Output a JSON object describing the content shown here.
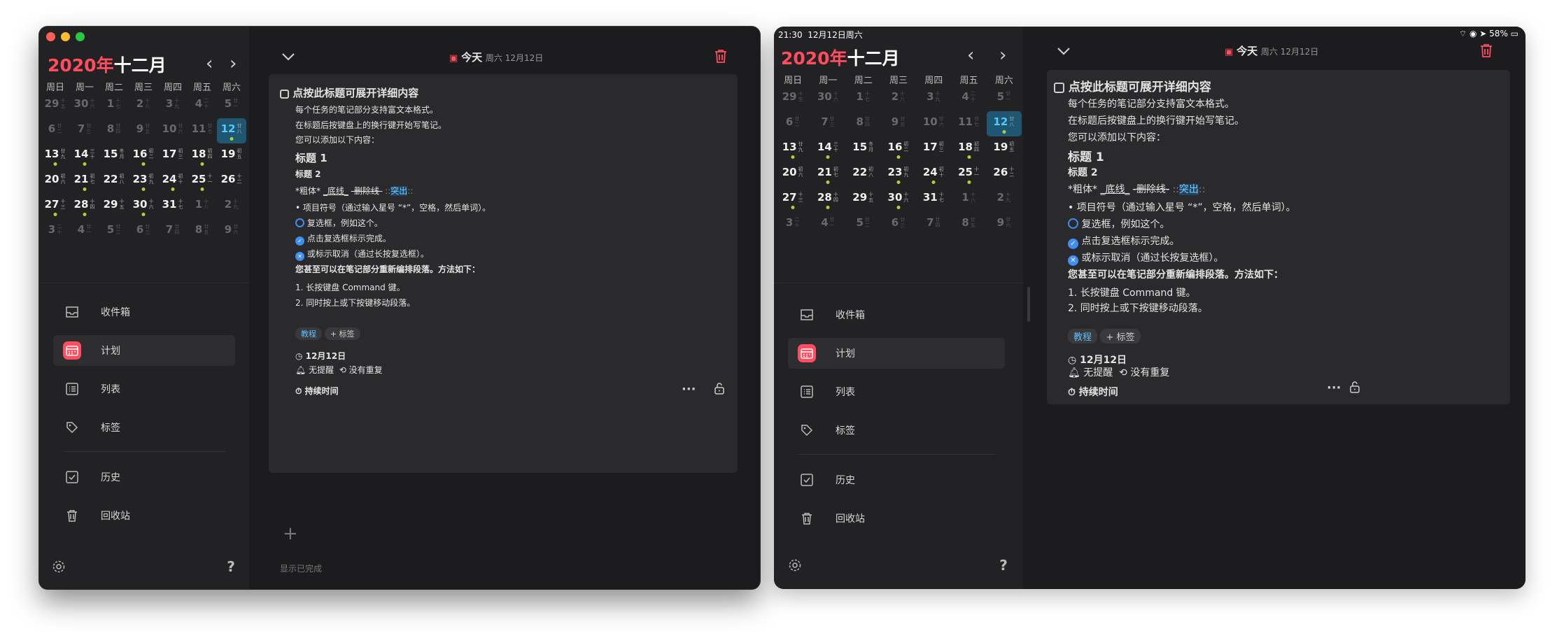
{
  "calendar": {
    "year": "2020年",
    "month": "十二月",
    "weekdays": [
      "周日",
      "周一",
      "周二",
      "周三",
      "周四",
      "周五",
      "周六"
    ],
    "weeks": [
      [
        {
          "d": "29",
          "l": "十五",
          "m": 1
        },
        {
          "d": "30",
          "l": "十六",
          "m": 1
        },
        {
          "d": "1",
          "l": "十七",
          "m": 1
        },
        {
          "d": "2",
          "l": "十八",
          "m": 1
        },
        {
          "d": "3",
          "l": "十九",
          "m": 1
        },
        {
          "d": "4",
          "l": "二十",
          "m": 1
        },
        {
          "d": "5",
          "l": "廿一",
          "m": 1
        }
      ],
      [
        {
          "d": "6",
          "l": "廿二",
          "m": 1
        },
        {
          "d": "7",
          "l": "廿三",
          "m": 1
        },
        {
          "d": "8",
          "l": "廿四",
          "m": 1
        },
        {
          "d": "9",
          "l": "廿五",
          "m": 1
        },
        {
          "d": "10",
          "l": "廿六",
          "m": 1
        },
        {
          "d": "11",
          "l": "廿七",
          "m": 1
        },
        {
          "d": "12",
          "l": "廿八",
          "t": 1,
          "dot": 1
        }
      ],
      [
        {
          "d": "13",
          "l": "廿九",
          "dot": 1
        },
        {
          "d": "14",
          "l": "三十",
          "dot": 1
        },
        {
          "d": "15",
          "l": "冬月"
        },
        {
          "d": "16",
          "l": "初二",
          "dot": 1
        },
        {
          "d": "17",
          "l": "初三"
        },
        {
          "d": "18",
          "l": "初四",
          "dot": 1
        },
        {
          "d": "19",
          "l": "初五"
        }
      ],
      [
        {
          "d": "20",
          "l": "初六"
        },
        {
          "d": "21",
          "l": "初七",
          "dot": 1
        },
        {
          "d": "22",
          "l": "初八"
        },
        {
          "d": "23",
          "l": "初九",
          "dot": 1
        },
        {
          "d": "24",
          "l": "初十",
          "dot": 1
        },
        {
          "d": "25",
          "l": "十一",
          "dot": 1
        },
        {
          "d": "26",
          "l": "十二"
        }
      ],
      [
        {
          "d": "27",
          "l": "十三",
          "dot": 1
        },
        {
          "d": "28",
          "l": "十四",
          "dot": 1
        },
        {
          "d": "29",
          "l": "十五"
        },
        {
          "d": "30",
          "l": "十六",
          "dot": 1
        },
        {
          "d": "31",
          "l": "十七"
        },
        {
          "d": "1",
          "l": "十八",
          "m": 1
        },
        {
          "d": "2",
          "l": "十九",
          "m": 1
        }
      ],
      [
        {
          "d": "3",
          "l": "二十",
          "m": 1
        },
        {
          "d": "4",
          "l": "廿一",
          "m": 1
        },
        {
          "d": "5",
          "l": "廿二",
          "m": 1
        },
        {
          "d": "6",
          "l": "廿三",
          "m": 1
        },
        {
          "d": "7",
          "l": "廿四",
          "m": 1
        },
        {
          "d": "8",
          "l": "廿五",
          "m": 1
        },
        {
          "d": "9",
          "l": "廿六",
          "m": 1
        }
      ]
    ]
  },
  "menu": {
    "inbox": "收件箱",
    "plan": "计划",
    "list": "列表",
    "tags": "标签",
    "history": "历史",
    "trash": "回收站"
  },
  "header": {
    "today": "今天",
    "date": "周六 12月12日"
  },
  "task": {
    "title": "点按此标题可展开详细内容",
    "line1": "每个任务的笔记部分支持富文本格式。",
    "line2": "在标题后按键盘上的换行键开始写笔记。",
    "line3": "您可以添加以下内容：",
    "h1": "标题 1",
    "h2": "标题 2",
    "fmt_bold": "*粗体*",
    "fmt_ul": "_底线_",
    "fmt_st": "-删除线-",
    "fmt_hl_pre": "::",
    "fmt_hl": "突出",
    "fmt_hl_post": "::",
    "bullet": "项目符号（通过输入星号 “*”，空格，然后单词）。",
    "check_open": "复选框，例如这个。",
    "check_done": "点击复选框标示完成。",
    "check_cancel": "或标示取消（通过长按复选框）。",
    "reorder": "您甚至可以在笔记部分重新编排段落。方法如下：",
    "step1": "1. 长按键盘 Command 键。",
    "step2": "2. 同时按上或下按键移动段落。",
    "tag": "教程",
    "add_tag": "+ 标签",
    "date": "12月12日",
    "reminder": "无提醒",
    "repeat": "没有重复",
    "duration": "持续时间"
  },
  "footer": {
    "show_done": "显示已完成"
  },
  "statusbar": {
    "time": "21:30",
    "date": "12月12日周六",
    "battery": "58%"
  },
  "colors": {
    "accent": "#ff4d5e",
    "today": "#58c8ff",
    "dot": "#a8d43a",
    "check": "#3f8ef0"
  },
  "icons": [
    "inbox-icon",
    "calendar-icon",
    "list-icon",
    "tag-icon",
    "history-icon",
    "trash-icon",
    "settings-icon",
    "help-icon",
    "chevron-down-icon",
    "delete-icon",
    "more-icon",
    "lock-icon",
    "plus-icon",
    "clock-icon",
    "bell-icon",
    "repeat-icon",
    "timer-icon"
  ]
}
